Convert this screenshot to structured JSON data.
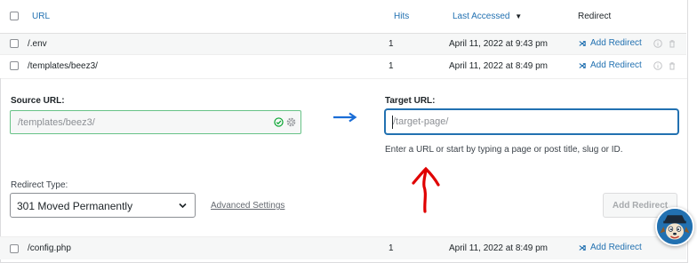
{
  "table": {
    "headers": {
      "url": "URL",
      "hits": "Hits",
      "last_accessed": "Last Accessed",
      "sort_indicator": "▼",
      "redirect": "Redirect"
    },
    "rows": [
      {
        "url": "/.env",
        "hits": "1",
        "last_accessed": "April 11, 2022 at 9:43 pm",
        "action": "Add Redirect"
      },
      {
        "url": "/templates/beez3/",
        "hits": "1",
        "last_accessed": "April 11, 2022 at 8:49 pm",
        "action": "Add Redirect"
      },
      {
        "url": "/config.php",
        "hits": "1",
        "last_accessed": "April 11, 2022 at 8:49 pm",
        "action": "Add Redirect"
      }
    ]
  },
  "form": {
    "source_label": "Source URL:",
    "source_value": "/templates/beez3/",
    "target_label": "Target URL:",
    "target_placeholder": "/target-page/",
    "target_value": "",
    "help_text": "Enter a URL or start by typing a page or post title, slug or ID.",
    "redirect_type_label": "Redirect Type:",
    "redirect_type_value": "301 Moved Permanently",
    "advanced_settings": "Advanced Settings",
    "add_button": "Add Redirect"
  },
  "colors": {
    "link": "#2271b1",
    "valid": "#68c387",
    "annotation": "#e00000",
    "arrow": "#1a6dd6"
  },
  "icons": [
    "checkbox",
    "sort-down-icon",
    "shuffle-icon",
    "info-icon",
    "trash-icon",
    "check-circle-icon",
    "gear-icon",
    "arrow-right-icon",
    "chevron-down-icon",
    "annotation-arrow",
    "mascot-avatar"
  ]
}
